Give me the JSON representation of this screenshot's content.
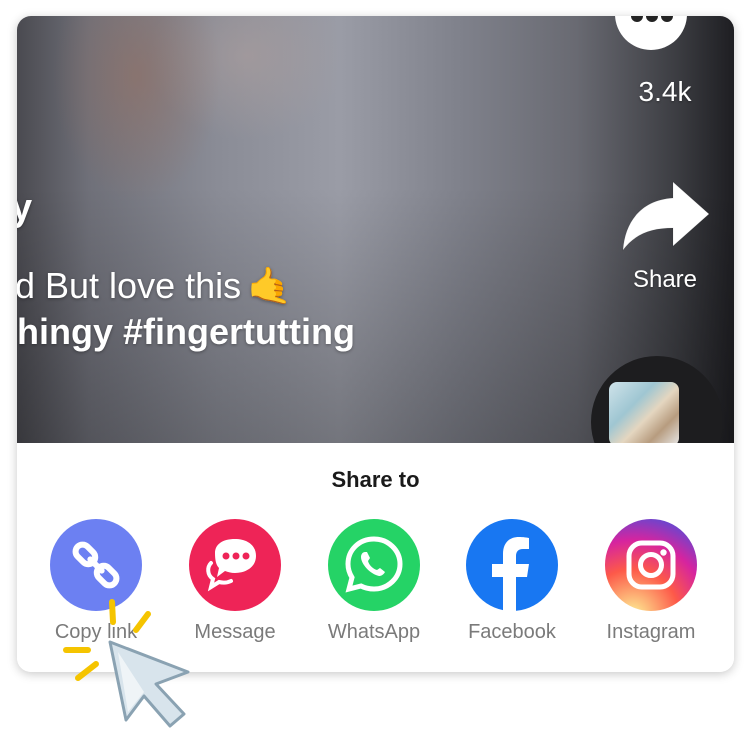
{
  "video": {
    "caption_username": "y",
    "caption_line1": "d But love this",
    "caption_line1_emoji": "🤙",
    "caption_line2": "hingy #fingertutting"
  },
  "rail": {
    "comments_count": "3.4k",
    "share_label": "Share"
  },
  "share_sheet": {
    "title": "Share to",
    "options": [
      {
        "label": "Copy link",
        "icon": "link-icon",
        "color": "#6c80f2"
      },
      {
        "label": "Message",
        "icon": "message-icon",
        "color": "#ee2457"
      },
      {
        "label": "WhatsApp",
        "icon": "whatsapp-icon",
        "color": "#25d366"
      },
      {
        "label": "Facebook",
        "icon": "facebook-icon",
        "color": "#1877f2"
      },
      {
        "label": "Instagram",
        "icon": "instagram-icon",
        "color": "#d6249f"
      }
    ]
  },
  "cursor": {
    "icon": "pointer-cursor-icon",
    "highlight_color": "#f5c400"
  }
}
